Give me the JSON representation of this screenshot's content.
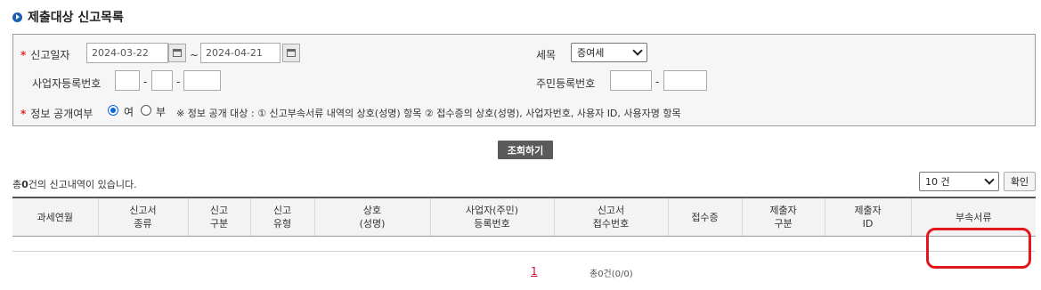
{
  "page": {
    "title": "제출대상 신고목록"
  },
  "form": {
    "report_date": {
      "label": "신고일자",
      "from": "2024-03-22",
      "tilde": "~",
      "to": "2024-04-21"
    },
    "tax_item": {
      "label": "세목",
      "selected": "증여세"
    },
    "biz_reg_no": {
      "label": "사업자등록번호",
      "sep": "-"
    },
    "resident_no": {
      "label": "주민등록번호",
      "sep": "-"
    },
    "disclosure": {
      "label": "정보 공개여부",
      "option_yes": "여",
      "option_no": "부",
      "selected": "여",
      "note": "※ 정보 공개 대상 : ① 신고부속서류 내역의 상호(성명) 항목 ② 접수증의 상호(성명), 사업자번호, 사용자 ID, 사용자명 항목"
    },
    "required_mark": "*"
  },
  "search_button": "조회하기",
  "result": {
    "prefix": "총",
    "count": "0",
    "suffix": "건의 신고내역이 있습니다.",
    "page_size": "10 건",
    "confirm": "확인"
  },
  "table": {
    "headers": [
      "과세연월",
      "신고서\n종류",
      "신고\n구분",
      "신고\n유형",
      "상호\n(성명)",
      "사업자(주민)\n등록번호",
      "신고서\n접수번호",
      "접수증",
      "제출자\n구분",
      "제출자\nID",
      "부속서류"
    ]
  },
  "pagination": {
    "current": "1",
    "total": "총0건(0/0)"
  },
  "colors": {
    "accent": "#1c5fb0",
    "required": "#e0282e",
    "highlight": "#e3171b"
  }
}
